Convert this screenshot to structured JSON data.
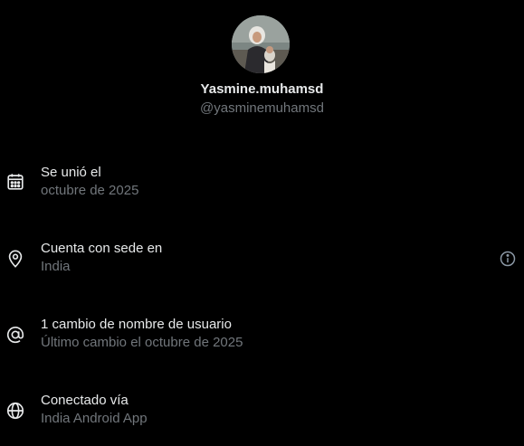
{
  "profile": {
    "display_name": "Yasmine.muhamsd",
    "handle": "@yasminemuhamsd",
    "avatar_icon": "profile-photo"
  },
  "details": [
    {
      "icon": "calendar-icon",
      "title": "Se unió el",
      "subtitle": "octubre de 2025"
    },
    {
      "icon": "location-pin-icon",
      "title": "Cuenta con sede en",
      "subtitle": "India",
      "trailing_icon": "info-icon"
    },
    {
      "icon": "at-sign-icon",
      "title": "1 cambio de nombre de usuario",
      "subtitle": "Último cambio el octubre de 2025"
    },
    {
      "icon": "globe-icon",
      "title": "Conectado vía",
      "subtitle": "India Android App"
    }
  ],
  "colors": {
    "background": "#000000",
    "primary_text": "#e7e9ea",
    "secondary_text": "#71767b"
  }
}
